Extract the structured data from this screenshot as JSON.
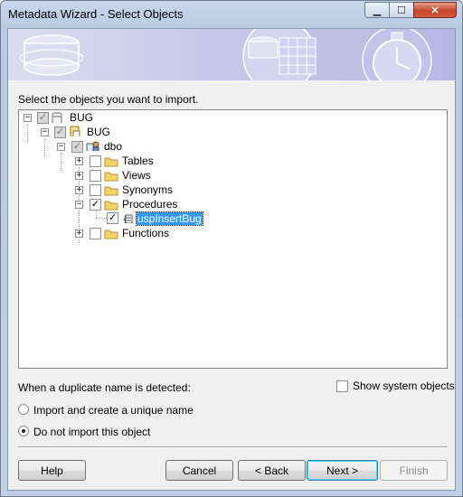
{
  "window": {
    "title": "Metadata Wizard - Select Objects"
  },
  "titlebar_buttons": {
    "minimize": "▁",
    "maximize": "☐",
    "close": "✕"
  },
  "prompt": "Select the objects you want to import.",
  "tree": {
    "root": {
      "label": "BUG",
      "checked": "indeterminate",
      "expanded": true
    },
    "database": {
      "label": "BUG",
      "checked": "indeterminate",
      "expanded": true
    },
    "schema": {
      "label": "dbo",
      "checked": "indeterminate",
      "expanded": true
    },
    "categories": [
      {
        "label": "Tables",
        "checked": false
      },
      {
        "label": "Views",
        "checked": false
      },
      {
        "label": "Synonyms",
        "checked": false
      },
      {
        "label": "Procedures",
        "checked": true
      },
      {
        "label": "Functions",
        "checked": false
      }
    ],
    "procedure_item": {
      "label": "uspInsertBug",
      "checked": true,
      "selected": true
    }
  },
  "duplicate_label": "When a duplicate name is detected:",
  "show_system_objects": {
    "label": "Show system objects",
    "checked": false
  },
  "options": [
    {
      "label": "Import and create a unique name",
      "selected": false
    },
    {
      "label": "Do not import this object",
      "selected": true
    }
  ],
  "buttons": {
    "help": "Help",
    "cancel": "Cancel",
    "back": "< Back",
    "next": "Next >",
    "finish": "Finish"
  },
  "colors": {
    "selection": "#3399ff",
    "folder": "#f5d26b",
    "banner": "#c9c8ea"
  }
}
